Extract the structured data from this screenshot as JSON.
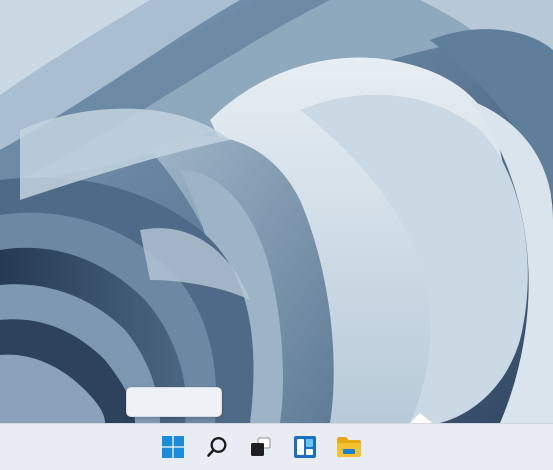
{
  "desktop": {
    "wallpaper": "windows-11-bloom-wallpaper"
  },
  "tooltip": {
    "text": ""
  },
  "taskbar": {
    "items": [
      {
        "name": "start",
        "icon": "windows-logo-icon"
      },
      {
        "name": "search",
        "icon": "search-icon"
      },
      {
        "name": "task-view",
        "icon": "task-view-icon"
      },
      {
        "name": "widgets",
        "icon": "widgets-icon"
      },
      {
        "name": "file-explorer",
        "icon": "folder-icon"
      }
    ],
    "colors": {
      "accent": "#1a8cdb",
      "folder": "#f4c12e",
      "background": "#e9edf3"
    }
  }
}
